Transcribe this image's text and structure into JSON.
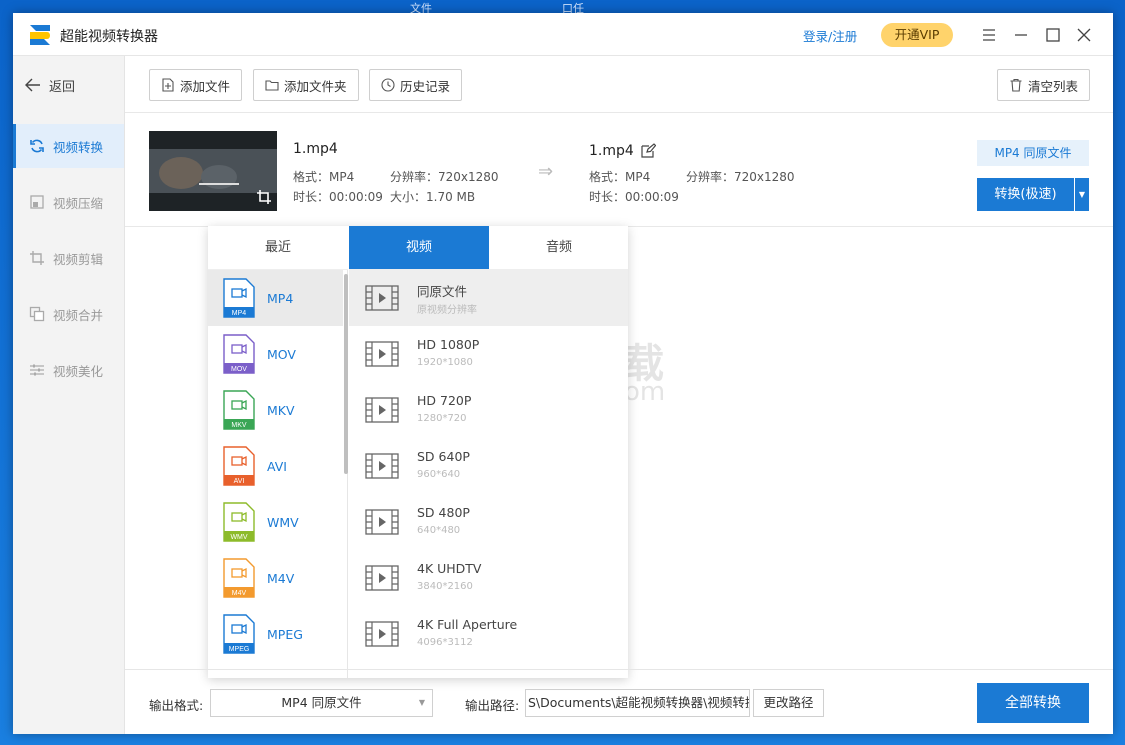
{
  "app": {
    "title": "超能视频转换器",
    "login": "登录/注册",
    "vip": "开通VIP"
  },
  "sidebar": {
    "back": "返回",
    "items": [
      {
        "label": "视频转换",
        "icon": "refresh-icon"
      },
      {
        "label": "视频压缩",
        "icon": "compress-icon"
      },
      {
        "label": "视频剪辑",
        "icon": "crop-icon"
      },
      {
        "label": "视频合并",
        "icon": "merge-icon"
      },
      {
        "label": "视频美化",
        "icon": "adjust-icon"
      }
    ]
  },
  "toolbar": {
    "add_file": "添加文件",
    "add_folder": "添加文件夹",
    "history": "历史记录",
    "clear": "清空列表"
  },
  "file": {
    "source": {
      "name": "1.mp4",
      "format": "格式：MP4",
      "resolution": "分辨率：720x1280",
      "duration": "时长：00:00:09",
      "size": "大小：1.70 MB"
    },
    "target": {
      "name": "1.mp4",
      "format": "格式：MP4",
      "resolution": "分辨率：720x1280",
      "duration": "时长：00:00:09"
    },
    "format_chip": "MP4 同原文件",
    "convert": "转换(极速)"
  },
  "popup": {
    "tabs": [
      "最近",
      "视频",
      "音频"
    ],
    "formats": [
      {
        "name": "MP4",
        "color": "#1b7ad4"
      },
      {
        "name": "MOV",
        "color": "#7b5fc9"
      },
      {
        "name": "MKV",
        "color": "#3aa655"
      },
      {
        "name": "AVI",
        "color": "#e8602c"
      },
      {
        "name": "WMV",
        "color": "#8dbb2a"
      },
      {
        "name": "M4V",
        "color": "#f39a2e"
      },
      {
        "name": "MPEG",
        "color": "#1b7ad4"
      }
    ],
    "presets": [
      {
        "name": "同原文件",
        "sub": "原视频分辨率"
      },
      {
        "name": "HD 1080P",
        "sub": "1920*1080"
      },
      {
        "name": "HD 720P",
        "sub": "1280*720"
      },
      {
        "name": "SD 640P",
        "sub": "960*640"
      },
      {
        "name": "SD 480P",
        "sub": "640*480"
      },
      {
        "name": "4K UHDTV",
        "sub": "3840*2160"
      },
      {
        "name": "4K Full Aperture",
        "sub": "4096*3112"
      }
    ]
  },
  "watermark": {
    "title": "安下载",
    "sub": "anxz.com"
  },
  "bottom": {
    "format_label": "输出格式:",
    "format_value": "MP4 同原文件",
    "path_label": "输出路径:",
    "path_value": "S\\Documents\\超能视频转换器\\视频转换",
    "change_path": "更改路径",
    "convert_all": "全部转换"
  },
  "desktop_bleed": [
    "文件",
    "口任"
  ]
}
